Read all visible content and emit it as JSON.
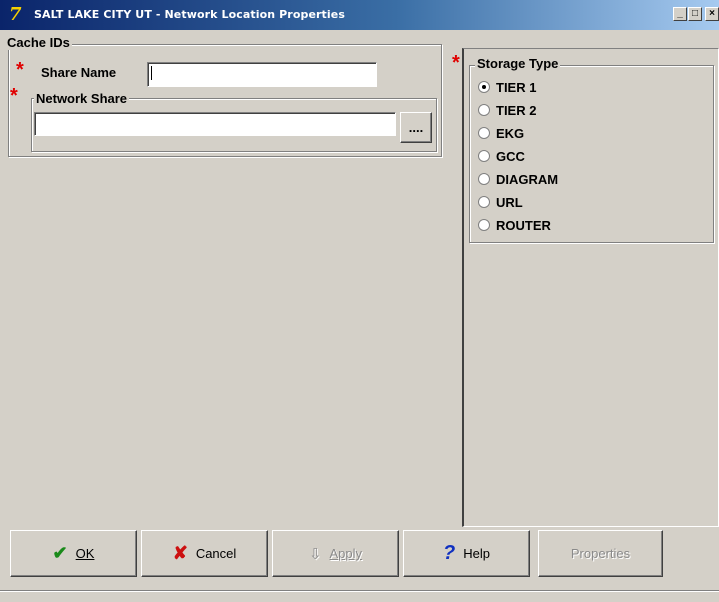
{
  "window": {
    "title": "SALT LAKE CITY UT  - Network Location Properties",
    "minimize": "_",
    "maximize": "□",
    "close": "×"
  },
  "cache_ids": {
    "legend": "Cache IDs",
    "required_marker": "*",
    "share_name_label": "Share Name",
    "share_name_value": "",
    "network_share_legend": "Network Share",
    "network_share_value": "",
    "browse_label": "...."
  },
  "storage_type": {
    "required_marker": "*",
    "legend": "Storage Type",
    "options": [
      {
        "label": "TIER 1",
        "checked": true
      },
      {
        "label": "TIER 2",
        "checked": false
      },
      {
        "label": "EKG",
        "checked": false
      },
      {
        "label": "GCC",
        "checked": false
      },
      {
        "label": "DIAGRAM",
        "checked": false
      },
      {
        "label": "URL",
        "checked": false
      },
      {
        "label": "ROUTER",
        "checked": false
      }
    ]
  },
  "buttons": {
    "ok": "OK",
    "cancel": "Cancel",
    "apply": "Apply",
    "help": "Help",
    "properties": "Properties"
  },
  "colors": {
    "face": "#d4d0c8",
    "required": "#e00000",
    "ok_check": "#1a8a1a",
    "cancel_x": "#cc1010",
    "help_q": "#1030c0"
  }
}
